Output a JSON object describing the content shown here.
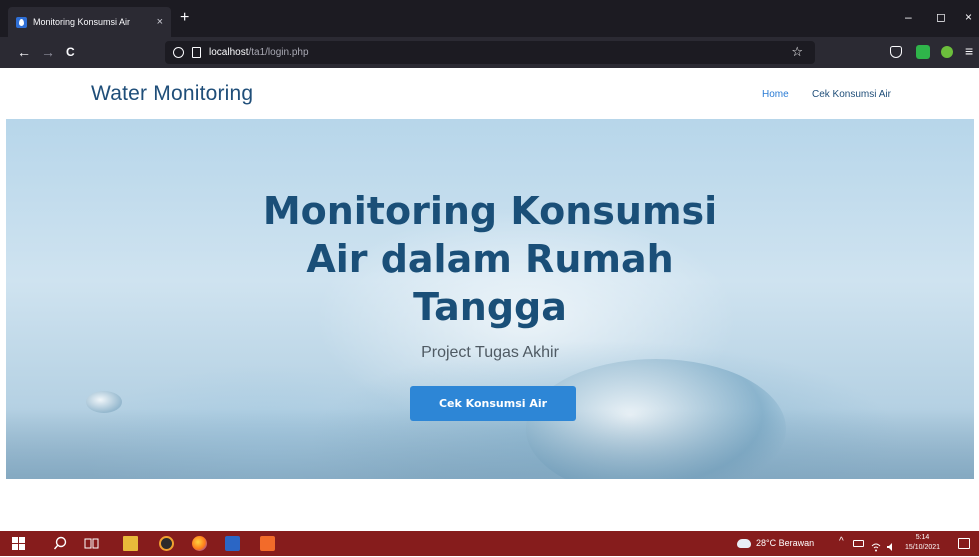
{
  "browser": {
    "tab_title": "Monitoring Konsumsi Air",
    "tab_close": "×",
    "new_tab": "+",
    "url_host": "localhost",
    "url_path": "/ta1/login.php",
    "bookmark_star": "☆",
    "window_minimize": "–",
    "window_restore": "◻",
    "window_close": "×",
    "nav_back": "←",
    "nav_forward": "→",
    "nav_reload": "C",
    "menu": "≡"
  },
  "site": {
    "brand": "Water Monitoring",
    "menu": {
      "home": "Home",
      "cek": "Cek Konsumsi Air"
    },
    "hero": {
      "title_line1": "Monitoring Konsumsi",
      "title_line2": "Air dalam Rumah",
      "title_line3": "Tangga",
      "subtitle": "Project Tugas Akhir",
      "button": "Cek Konsumsi Air"
    }
  },
  "taskbar": {
    "weather": "28°C  Berawan",
    "time": "5:14",
    "date": "15/10/2021",
    "tray_chevron": "^"
  },
  "colors": {
    "brand": "#1f4e79",
    "accent": "#2d86d6",
    "taskbar": "#861c1c",
    "chrome_dark": "#1c1b22"
  }
}
